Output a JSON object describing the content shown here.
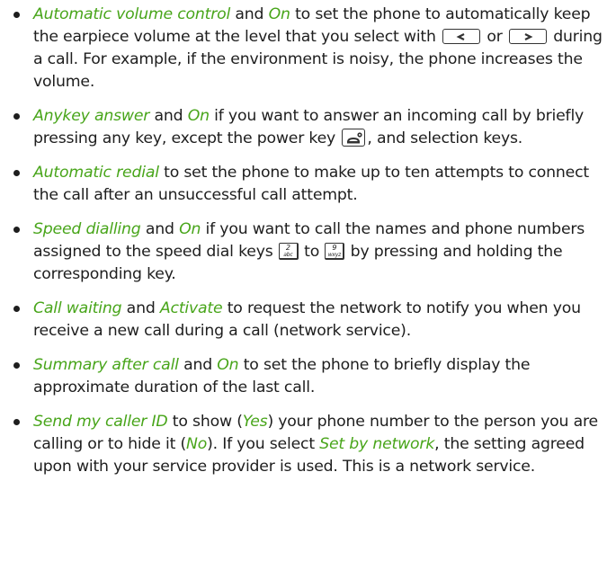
{
  "colors": {
    "accent": "#48a51a",
    "text": "#1e1e1e"
  },
  "items": [
    {
      "t1": "Automatic volume control",
      "t2": " and ",
      "t3": "On",
      "t4": " to set the phone to automatically keep the earpiece volume at the level that you select with ",
      "key1_icon": "left-arrow-key-icon",
      "t5": " or ",
      "key2_icon": "right-arrow-key-icon",
      "t6": " during a call. For example, if the environment is noisy, the phone increases the volume."
    },
    {
      "t1": "Anykey answer",
      "t2": " and ",
      "t3": "On",
      "t4": " if you want to answer an incoming call by briefly pressing any key, except the power key ",
      "key_icon": "power-end-key-icon",
      "t5": ", and selection keys."
    },
    {
      "t1": "Automatic redial",
      "t2": " to set the phone to make up to ten attempts to connect the call after an unsuccessful call attempt."
    },
    {
      "t1": "Speed dialling",
      "t2": " and ",
      "t3": "On",
      "t4": " if you want to call the names and phone numbers assigned to the speed dial keys ",
      "key1": {
        "digit": "2",
        "letters": "abc"
      },
      "t5": " to ",
      "key2": {
        "digit": "9",
        "letters": "wxyz"
      },
      "t6": " by pressing and holding the corresponding key."
    },
    {
      "t1": "Call waiting",
      "t2": " and ",
      "t3": "Activate",
      "t4": " to request the network to notify you when you receive a new call during a call (network service)."
    },
    {
      "t1": "Summary after call",
      "t2": " and ",
      "t3": "On",
      "t4": " to set the phone to briefly display the approximate duration of the last call."
    },
    {
      "t1": "Send my caller ID",
      "t2": " to show (",
      "t3": "Yes",
      "t4": ") your phone number to the person you are calling or to hide it (",
      "t5": "No",
      "t6": "). If you select ",
      "t7": "Set by network",
      "t8": ", the setting agreed upon with your service provider is used. This is a network service."
    }
  ]
}
